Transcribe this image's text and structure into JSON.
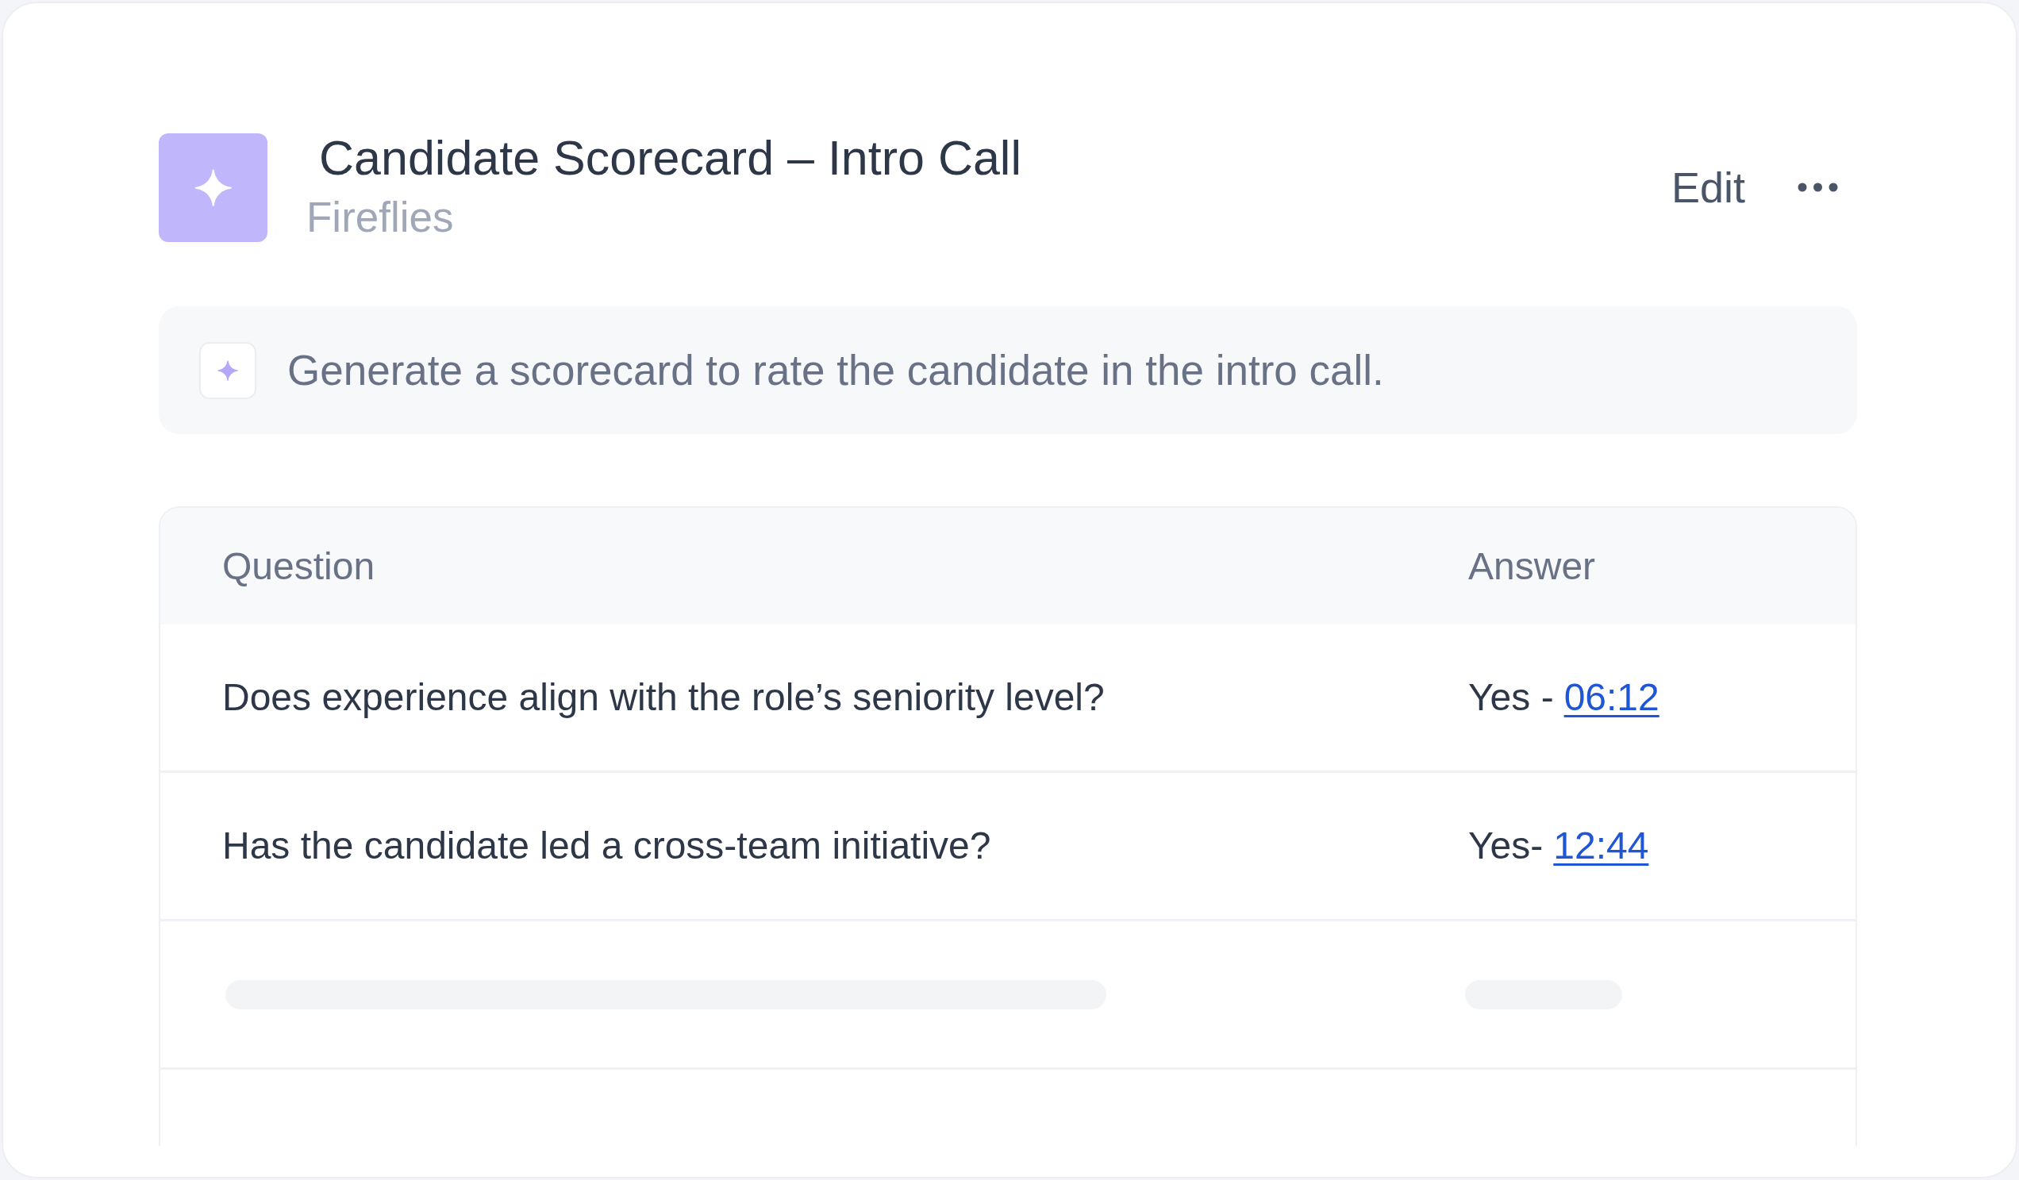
{
  "header": {
    "title": "Candidate Scorecard – Intro Call",
    "subtitle": "Fireflies",
    "edit_button": {
      "label": "Edit"
    }
  },
  "prompt": {
    "text": "Generate a scorecard to rate the candidate in the intro call."
  },
  "table": {
    "columns": [
      "Question",
      "Answer"
    ],
    "rows": [
      {
        "kind": "answered",
        "question": "Does experience align with the role’s seniority level?",
        "answer": "Yes -",
        "timestamp": "06:12"
      },
      {
        "kind": "answered",
        "question": "Has the candidate led a cross-team initiative?",
        "answer": "Yes-",
        "timestamp": "12:44"
      },
      {
        "kind": "loading"
      }
    ]
  }
}
